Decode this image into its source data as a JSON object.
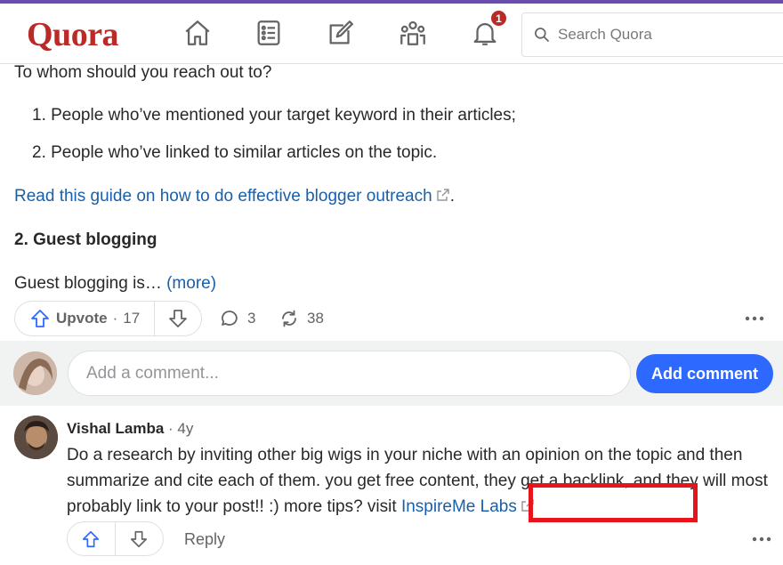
{
  "header": {
    "logo": "Quora",
    "notification_count": "1",
    "search_placeholder": "Search Quora",
    "nav": [
      {
        "name": "home-icon"
      },
      {
        "name": "following-icon"
      },
      {
        "name": "answer-icon"
      },
      {
        "name": "spaces-icon"
      },
      {
        "name": "notifications-icon"
      }
    ]
  },
  "answer": {
    "intro": "To whom should you reach out to?",
    "list": [
      "1. People who’ve mentioned your target keyword in their articles;",
      "2. People who’ve linked to similar articles on the topic."
    ],
    "guide_link": "Read this guide on how to do effective blogger outreach",
    "guide_suffix": ".",
    "heading": "2. Guest blogging",
    "snippet": "Guest blogging is… ",
    "more_link": "(more)"
  },
  "actions": {
    "upvote_label": "Upvote",
    "upvote_sep": "·",
    "upvote_count": "17",
    "comment_count": "3",
    "share_count": "38"
  },
  "comment_box": {
    "placeholder": "Add a comment...",
    "button": "Add comment"
  },
  "comment": {
    "author": "Vishal Lamba",
    "time": " · 4y",
    "body": "Do a research by inviting other big wigs in your niche with an opinion on the topic and then summarize and cite each of them. you get free content, they get a backlink, and they will most probably link to your post!! :) more tips? visit ",
    "link": "InspireMe Labs",
    "reply": "Reply"
  },
  "colors": {
    "brand": "#b92b27",
    "accent_bar": "#6a4caf",
    "link": "#195faa",
    "primary_button": "#2e69ff",
    "highlight_box": "#e8141b"
  }
}
